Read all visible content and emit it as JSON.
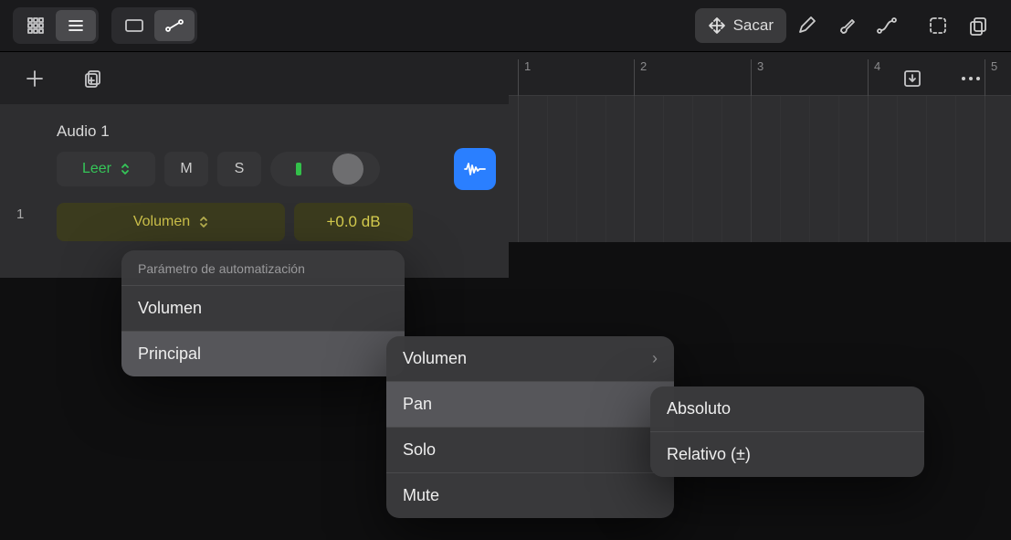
{
  "toolbar": {
    "sacar_label": "Sacar"
  },
  "ruler": {
    "marks": [
      "1",
      "2",
      "3",
      "4",
      "5"
    ]
  },
  "track": {
    "index": "1",
    "name": "Audio 1",
    "read_mode": "Leer",
    "mute_label": "M",
    "solo_label": "S",
    "param_label": "Volumen",
    "value_label": "+0.0 dB"
  },
  "menu1": {
    "header": "Parámetro de automatización",
    "items": [
      "Volumen",
      "Principal"
    ]
  },
  "menu2": {
    "items": [
      "Volumen",
      "Pan",
      "Solo",
      "Mute"
    ]
  },
  "menu3": {
    "items": [
      "Absoluto",
      "Relativo (±)"
    ]
  }
}
